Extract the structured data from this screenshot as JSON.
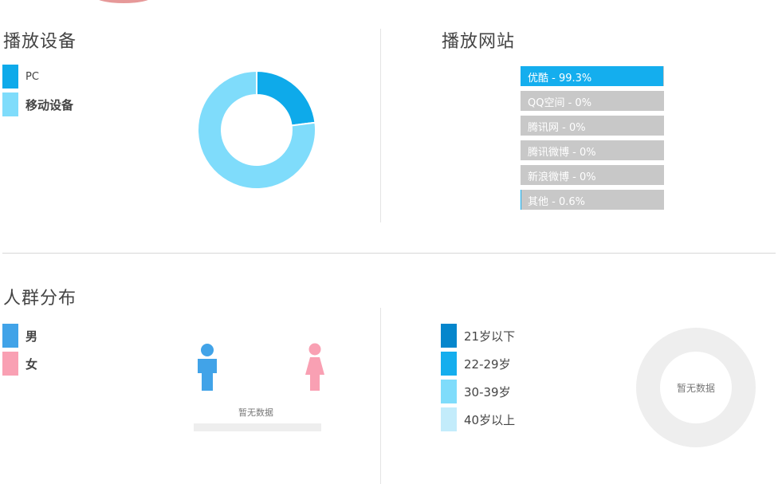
{
  "device": {
    "title": "播放设备",
    "legend": [
      {
        "label": "PC",
        "color": "#0eaaea",
        "bold": false
      },
      {
        "label": "移动设备",
        "color": "#7fdcfb",
        "bold": true
      }
    ],
    "chart_data": {
      "type": "pie",
      "categories": [
        "PC",
        "移动设备"
      ],
      "values": [
        23,
        77
      ],
      "colors": [
        "#0eaaea",
        "#7fdcfb"
      ]
    }
  },
  "sites": {
    "title": "播放网站",
    "items": [
      {
        "label": "优酷 - 99.3%",
        "value": 99.3
      },
      {
        "label": "QQ空间 - 0%",
        "value": 0
      },
      {
        "label": "腾讯网 - 0%",
        "value": 0
      },
      {
        "label": "腾讯微博 - 0%",
        "value": 0
      },
      {
        "label": "新浪微博 - 0%",
        "value": 0
      },
      {
        "label": "其他 - 0.6%",
        "value": 0.6
      }
    ],
    "bar_color": "#14aeee",
    "track_color": "#c8c8c8"
  },
  "crowd": {
    "title": "人群分布",
    "gender_legend": [
      {
        "label": "男",
        "color": "#41a3e8"
      },
      {
        "label": "女",
        "color": "#f9a0b3"
      }
    ],
    "gender_no_data": "暂无数据",
    "male_icon": "male-person-icon",
    "female_icon": "female-person-icon",
    "age_legend": [
      {
        "label": "21岁以下",
        "color": "#0586cc"
      },
      {
        "label": "22-29岁",
        "color": "#14aeee"
      },
      {
        "label": "30-39岁",
        "color": "#7fdcfb"
      },
      {
        "label": "40岁以上",
        "color": "#c3ecfb"
      }
    ],
    "age_no_data": "暂无数据"
  }
}
